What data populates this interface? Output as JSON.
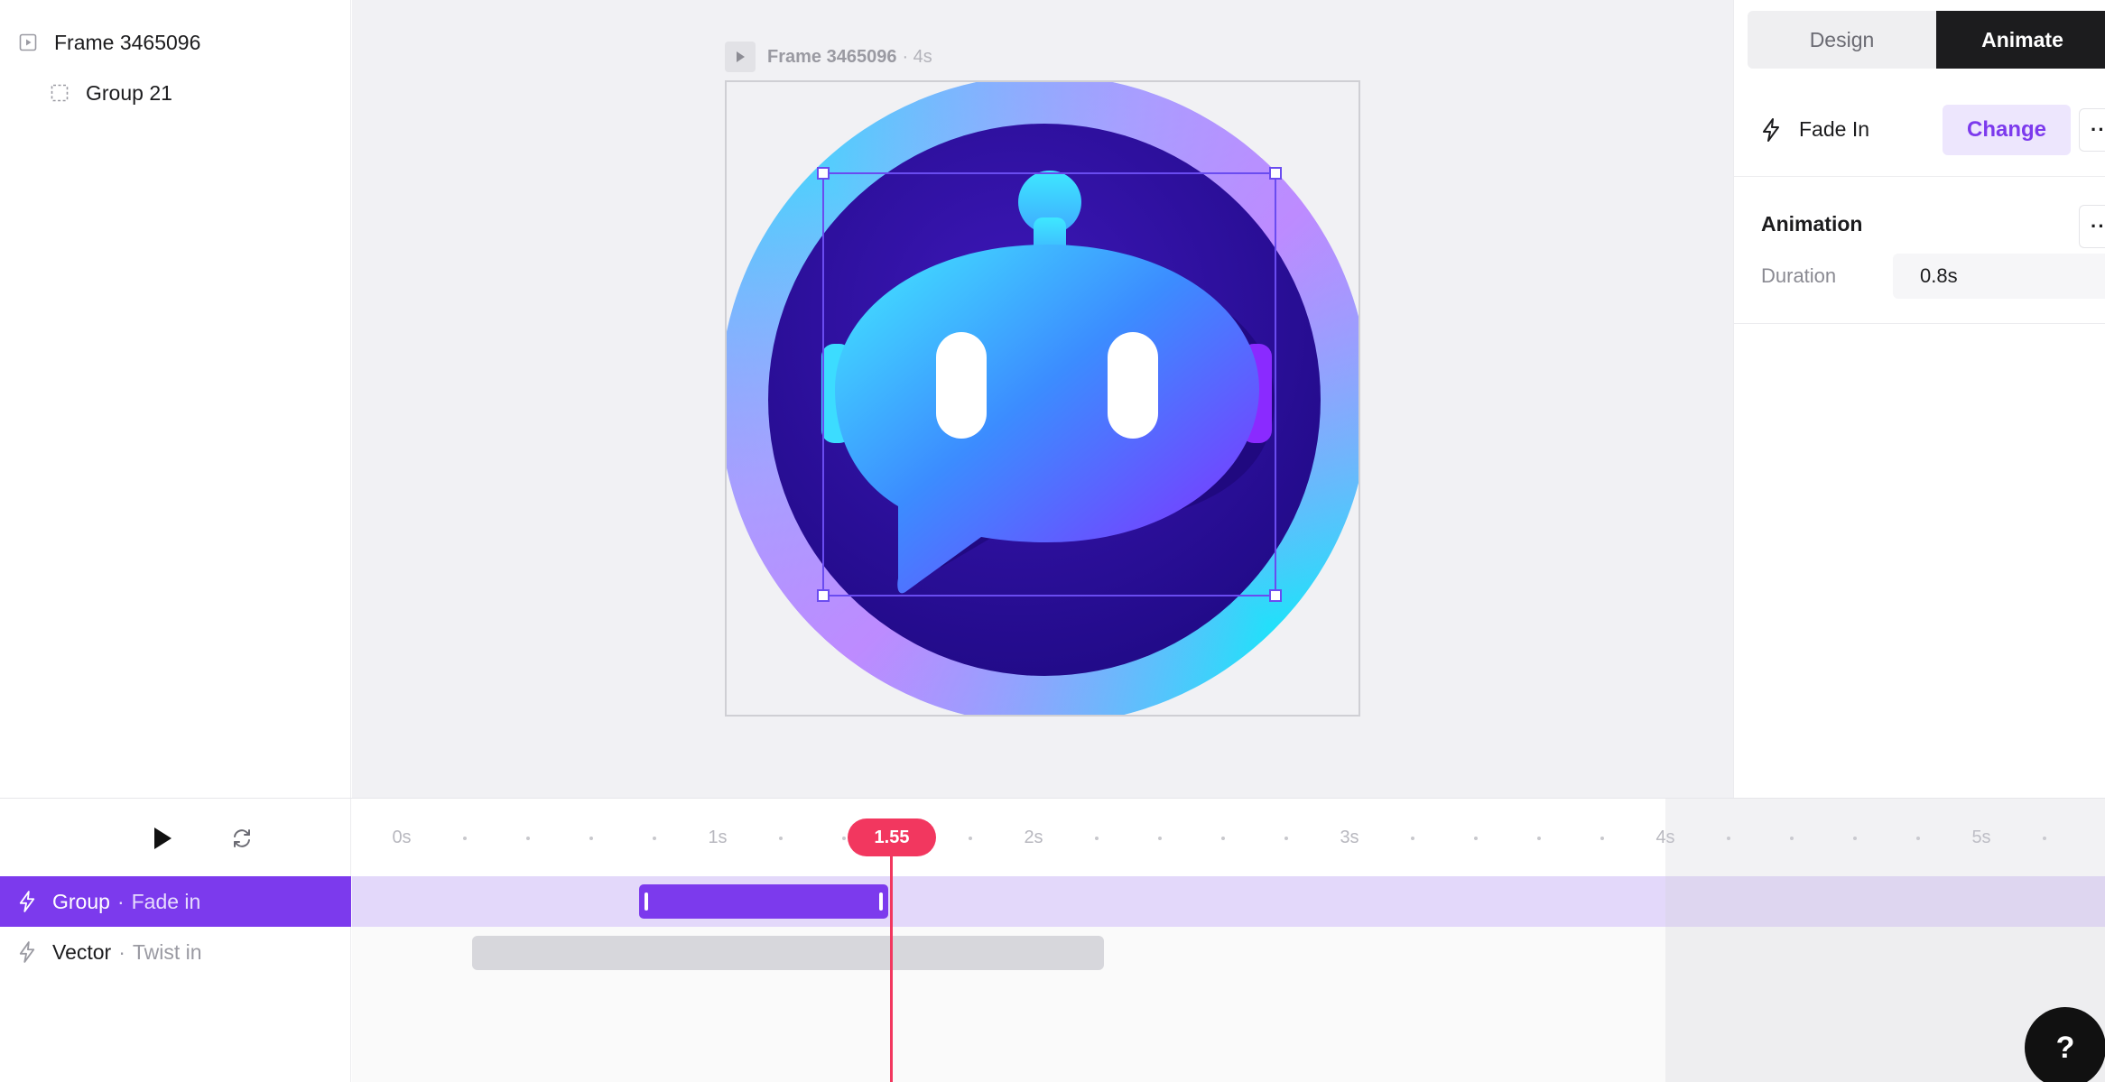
{
  "layers": {
    "frame": {
      "label": "Frame 3465096",
      "icon": "frame-play-icon"
    },
    "group": {
      "label": "Group 21",
      "icon": "group-dashed-icon"
    }
  },
  "canvas": {
    "frame_name": "Frame 3465096",
    "frame_duration": "· 4s",
    "artwork": "chat-bot-icon"
  },
  "inspector": {
    "tabs": [
      {
        "label": "Design",
        "active": false
      },
      {
        "label": "Animate",
        "active": true
      }
    ],
    "effect": {
      "name": "Fade In",
      "change_label": "Change",
      "more": "···"
    },
    "animation": {
      "title": "Animation",
      "more": "···",
      "duration_label": "Duration",
      "duration_value": "0.8s"
    }
  },
  "timeline": {
    "ticks": [
      "0s",
      "1s",
      "2s",
      "3s",
      "4s",
      "5s"
    ],
    "playhead": "1.55",
    "tracks": [
      {
        "name": "Group",
        "effect": "Fade in",
        "selected": true
      },
      {
        "name": "Vector",
        "effect": "Twist in",
        "selected": false
      }
    ]
  },
  "help": {
    "label": "?"
  },
  "colors": {
    "accent": "#7c3aed",
    "playhead": "#f2375f",
    "selected_lane": "#e3d8fa"
  }
}
